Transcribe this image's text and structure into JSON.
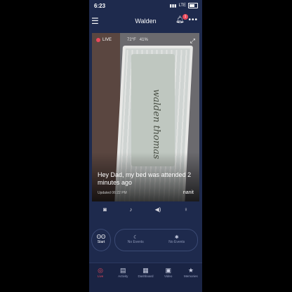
{
  "status_bar": {
    "time": "6:23",
    "network": "LTE"
  },
  "header": {
    "title": "Walden",
    "notification_count": "1"
  },
  "video": {
    "live_label": "LIVE",
    "temperature": "72°F",
    "humidity": "41%",
    "blanket_text": "walden thomas",
    "message": "Hey Dad, my bed was attended 2 minutes ago",
    "updated": "Updated 06:22 PM",
    "brand": "nanit"
  },
  "controls": [
    {
      "icon": "camera-icon",
      "glyph": "◙"
    },
    {
      "icon": "microphone-icon",
      "glyph": "♪"
    },
    {
      "icon": "speaker-icon",
      "glyph": "◀)"
    },
    {
      "icon": "nightlight-icon",
      "glyph": "♀"
    }
  ],
  "start": {
    "label": "Start"
  },
  "events": [
    {
      "icon": "moon-icon",
      "glyph": "☾",
      "label": "No Events"
    },
    {
      "icon": "sun-icon",
      "glyph": "✱",
      "label": "No Events"
    }
  ],
  "tabs": [
    {
      "label": "Live",
      "icon": "live-icon",
      "glyph": "◎",
      "active": true
    },
    {
      "label": "Activity",
      "icon": "activity-icon",
      "glyph": "▤",
      "active": false
    },
    {
      "label": "Dashboard",
      "icon": "dashboard-icon",
      "glyph": "▦",
      "active": false
    },
    {
      "label": "Video",
      "icon": "video-icon",
      "glyph": "▣",
      "active": false
    },
    {
      "label": "Memories",
      "icon": "star-icon",
      "glyph": "★",
      "active": false
    }
  ],
  "colors": {
    "background": "#1e2a4d",
    "accent": "#e9495b",
    "tabbar": "#1a2444"
  }
}
